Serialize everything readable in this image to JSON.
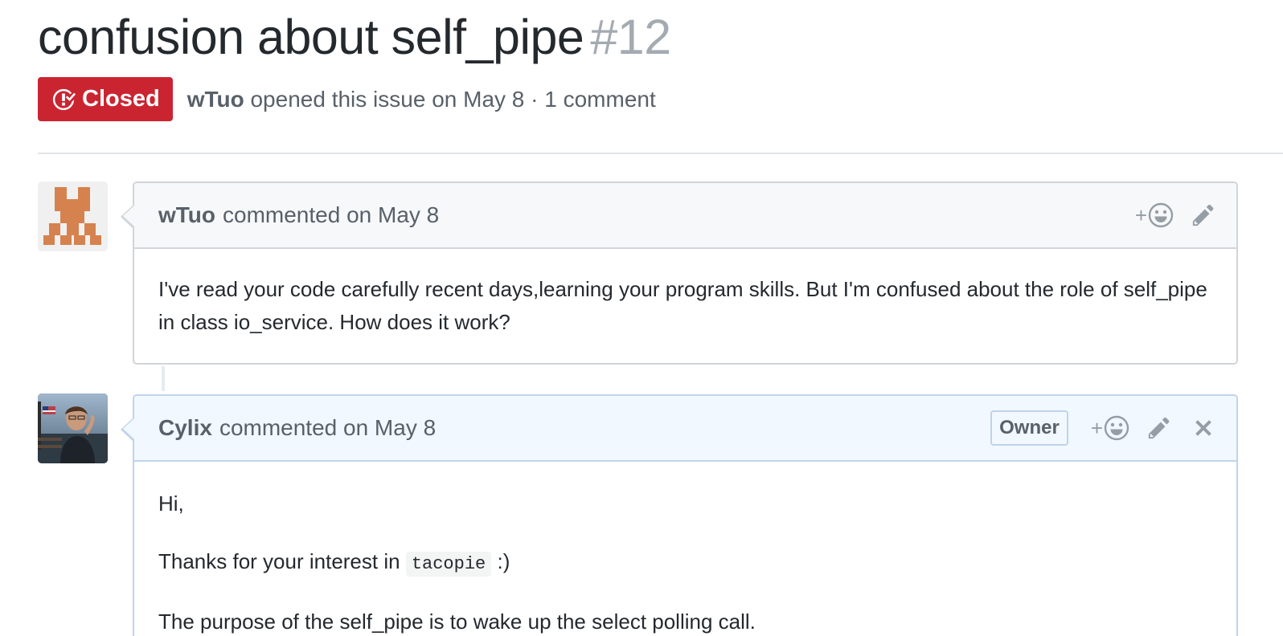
{
  "issue": {
    "title": "confusion about self_pipe",
    "number": "#12",
    "state": "Closed",
    "author": "wTuo",
    "opened_text": "opened this issue on May 8 · 1 comment"
  },
  "comments": [
    {
      "author": "wTuo",
      "meta": "commented on May 8",
      "body": "I've read your code carefully recent days,learning your program skills. But I'm confused about the role of self_pipe in class io_service. How does it work?"
    },
    {
      "author": "Cylix",
      "meta": "commented on May 8",
      "badge": "Owner",
      "greeting": "Hi,",
      "thanks_before": "Thanks for your interest in",
      "thanks_code": "tacopie",
      "thanks_after": ":)",
      "purpose": "The purpose of the self_pipe is to wake up the select polling call."
    }
  ],
  "icons": {
    "state": "issue-closed-icon",
    "reaction": "smiley-icon",
    "edit": "pencil-icon",
    "delete": "x-icon"
  },
  "colors": {
    "closed": "#cb2431",
    "owner_comment_header": "#f1f8ff",
    "default_comment_header": "#f6f8fa"
  }
}
